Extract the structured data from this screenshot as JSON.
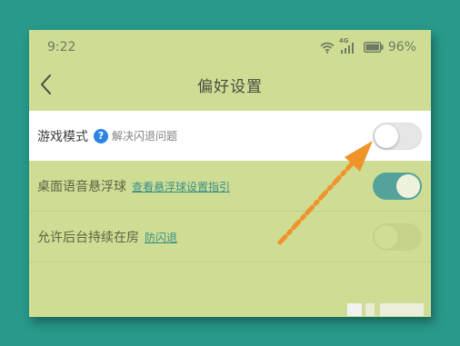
{
  "status_bar": {
    "time": "9:22",
    "network": "4G",
    "battery": "96%"
  },
  "header": {
    "title": "偏好设置",
    "back_icon": "chevron-left-icon"
  },
  "settings": [
    {
      "label": "游戏模式",
      "help_icon": "?",
      "sub": "解决闪退问题",
      "toggle": "off"
    },
    {
      "label": "桌面语音悬浮球",
      "link": "查看悬浮球设置指引",
      "toggle": "on"
    },
    {
      "label": "允许后台持续在房",
      "link": "防闪退",
      "toggle": "disabled"
    }
  ],
  "colors": {
    "background": "#2a9c8c",
    "screen": "#cedd93",
    "toggle_on": "#54a39a",
    "arrow": "#f0932b",
    "help_icon": "#2b84e3"
  }
}
